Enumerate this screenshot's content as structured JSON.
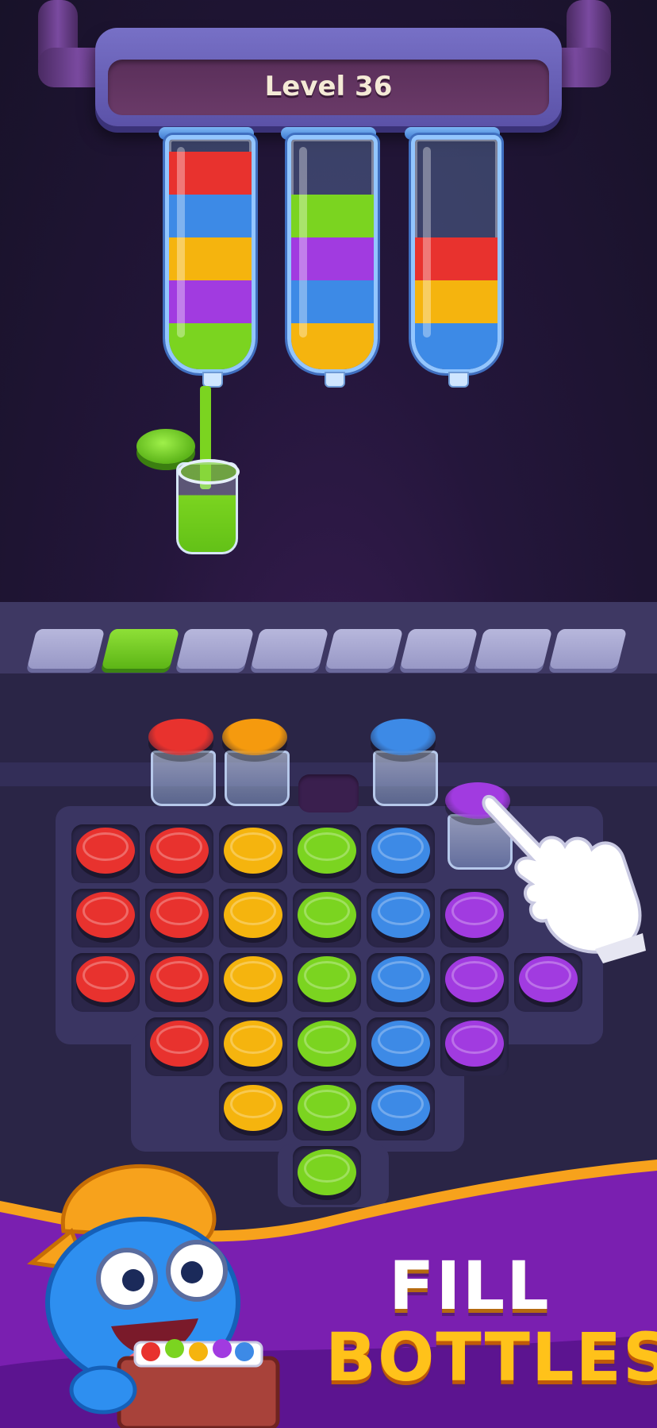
{
  "header": {
    "level_label": "Level 36"
  },
  "tubes": [
    {
      "layers": [
        "#e8322e",
        "#3d8ae6",
        "#f5b40e",
        "#a13be0",
        "#7bd420"
      ]
    },
    {
      "layers": [
        "#7bd420",
        "#a13be0",
        "#3d8ae6",
        "#f5b40e"
      ]
    },
    {
      "layers": [
        "#e8322e",
        "#f5b40e",
        "#3d8ae6"
      ]
    }
  ],
  "progress": {
    "slots_total": 8,
    "slots_filled": 1,
    "filled_color": "#7bd420"
  },
  "top_jars": [
    {
      "color": "#e8322e",
      "name": "red"
    },
    {
      "color": "#f59a0e",
      "name": "orange"
    },
    {
      "color": "empty",
      "name": "empty"
    },
    {
      "color": "#3d8ae6",
      "name": "blue"
    },
    {
      "color": "#a13be0",
      "name": "purple"
    }
  ],
  "grid": [
    [
      "#e8322e",
      "#e8322e",
      "#f5b40e",
      "#7bd420",
      "#3d8ae6",
      null,
      null
    ],
    [
      "#e8322e",
      "#e8322e",
      "#f5b40e",
      "#7bd420",
      "#3d8ae6",
      "#a13be0",
      null
    ],
    [
      "#e8322e",
      "#e8322e",
      "#f5b40e",
      "#7bd420",
      "#3d8ae6",
      "#a13be0",
      "#a13be0"
    ],
    [
      null,
      "#e8322e",
      "#f5b40e",
      "#7bd420",
      "#3d8ae6",
      "#a13be0",
      null
    ],
    [
      null,
      null,
      "#f5b40e",
      "#7bd420",
      "#3d8ae6",
      null,
      null
    ],
    [
      null,
      null,
      null,
      "#7bd420",
      null,
      null,
      null
    ]
  ],
  "promo": {
    "line1": "FILL",
    "line2": "BOTTLES"
  },
  "colors": {
    "accent_orange": "#f7a21c",
    "promo_purple": "#7a1fb0"
  },
  "icons": [
    "hand-pointer-icon",
    "mascot-character"
  ]
}
